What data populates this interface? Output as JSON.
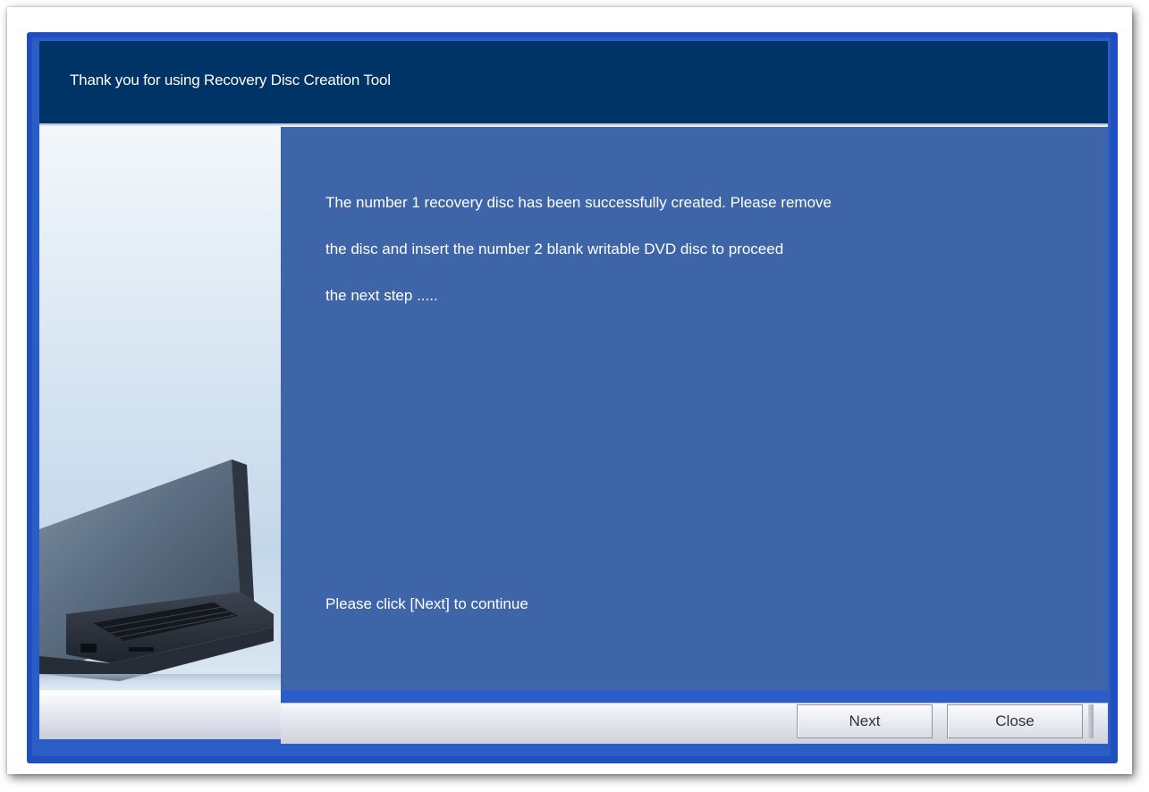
{
  "window": {
    "header_title": "Thank you for using Recovery Disc Creation Tool"
  },
  "content": {
    "message_lines": [
      "The number 1 recovery disc has been successfully created. Please remove",
      "the disc  and insert the number 2 blank writable DVD disc to proceed",
      "the next step ....."
    ],
    "instruction": "Please click [Next] to continue"
  },
  "buttons": {
    "next_label": "Next",
    "close_label": "Close"
  },
  "colors": {
    "header_bg": "#003366",
    "content_bg": "#3e65a8",
    "window_border": "#1f4fbf"
  },
  "images": {
    "side_image": "laptop-illustration"
  }
}
